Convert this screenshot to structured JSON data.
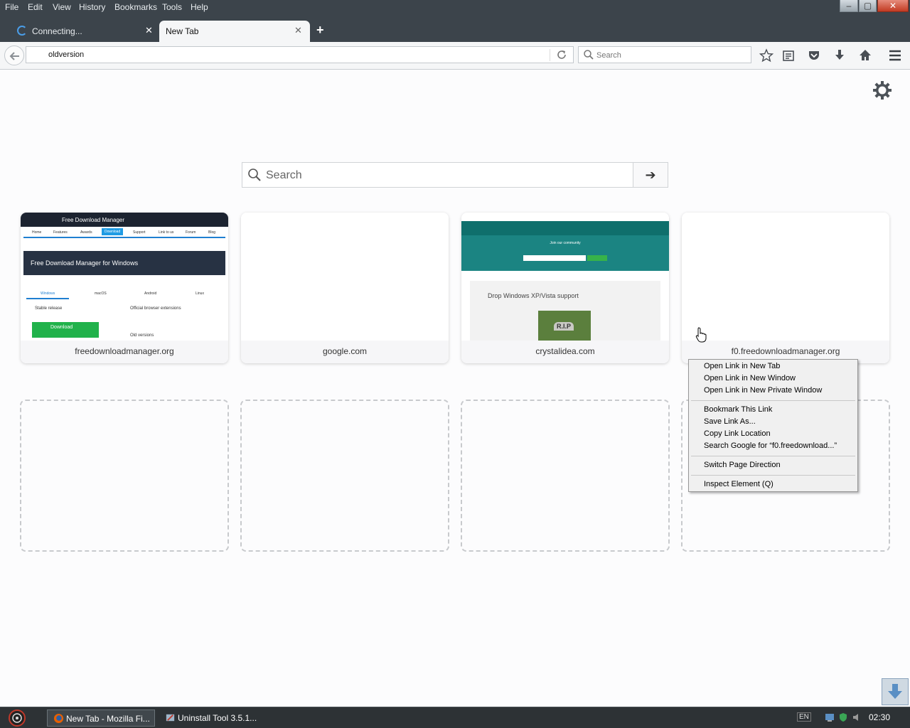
{
  "window": {
    "menus": [
      {
        "label": "File"
      },
      {
        "label": "Edit"
      },
      {
        "label": "View"
      },
      {
        "label": "History"
      },
      {
        "label": "Bookmarks"
      },
      {
        "label": "Tools"
      },
      {
        "label": "Help"
      }
    ],
    "controls": {
      "minimize": "–",
      "restore": "▢",
      "close": "✕"
    }
  },
  "tabs": [
    {
      "label": "Connecting...",
      "state": "loading"
    },
    {
      "label": "New Tab",
      "state": "active"
    }
  ],
  "tab_close_glyph": "✕",
  "new_tab_glyph": "+",
  "navbar": {
    "url_value": "oldversion",
    "search_placeholder": "Search",
    "icons": [
      "back-arrow-icon",
      "reload-icon",
      "search-icon",
      "star-icon",
      "reading-list-icon",
      "pocket-icon",
      "download-icon",
      "home-icon",
      "hamburger-menu-icon"
    ]
  },
  "newtab": {
    "search_placeholder": "Search",
    "go_glyph": "➔",
    "tiles": [
      {
        "caption": "freedownloadmanager.org",
        "thumb": {
          "header": "Free Download Manager",
          "nav": [
            "Home",
            "Features",
            "Awards",
            "Download",
            "Support",
            "Link to us",
            "Forum",
            "Blog"
          ],
          "hero": "Free Download Manager for Windows",
          "platforms": [
            "Windows",
            "macOS",
            "Android",
            "Linux"
          ],
          "stable": "Stable release",
          "extensions": "Official browser extensions",
          "download_label": "Download",
          "old": "Old versions"
        }
      },
      {
        "caption": "google.com"
      },
      {
        "caption": "crystalidea.com",
        "thumb": {
          "join": "Join our community",
          "article_title": "Drop Windows XP/Vista support",
          "stone": "R.I.P"
        }
      },
      {
        "caption": "f0.freedownloadmanager.org"
      }
    ]
  },
  "context_menu": {
    "items": [
      {
        "label": "Open Link in New Tab"
      },
      {
        "label": "Open Link in New Window"
      },
      {
        "label": "Open Link in New Private Window"
      },
      {
        "label": "Bookmark This Link"
      },
      {
        "label": "Save Link As..."
      },
      {
        "label": "Copy Link Location"
      },
      {
        "label": "Search Google for “f0.freedownload...”"
      },
      {
        "label": "Switch Page Direction"
      },
      {
        "label": "Inspect Element (Q)"
      }
    ]
  },
  "taskbar": {
    "tasks": [
      {
        "label": "New Tab - Mozilla Fi...",
        "active": true
      },
      {
        "label": "Uninstall Tool 3.5.1...",
        "active": false
      }
    ],
    "language": "EN",
    "clock": "02:30"
  },
  "colors": {
    "chrome_dark": "#3c444b",
    "toolbar": "#f5f6f7",
    "content_bg": "#fcfcfd",
    "accent_blue": "#1f9be4",
    "download_green": "#21b24b",
    "crystalidea_teal": "#1b8482"
  }
}
